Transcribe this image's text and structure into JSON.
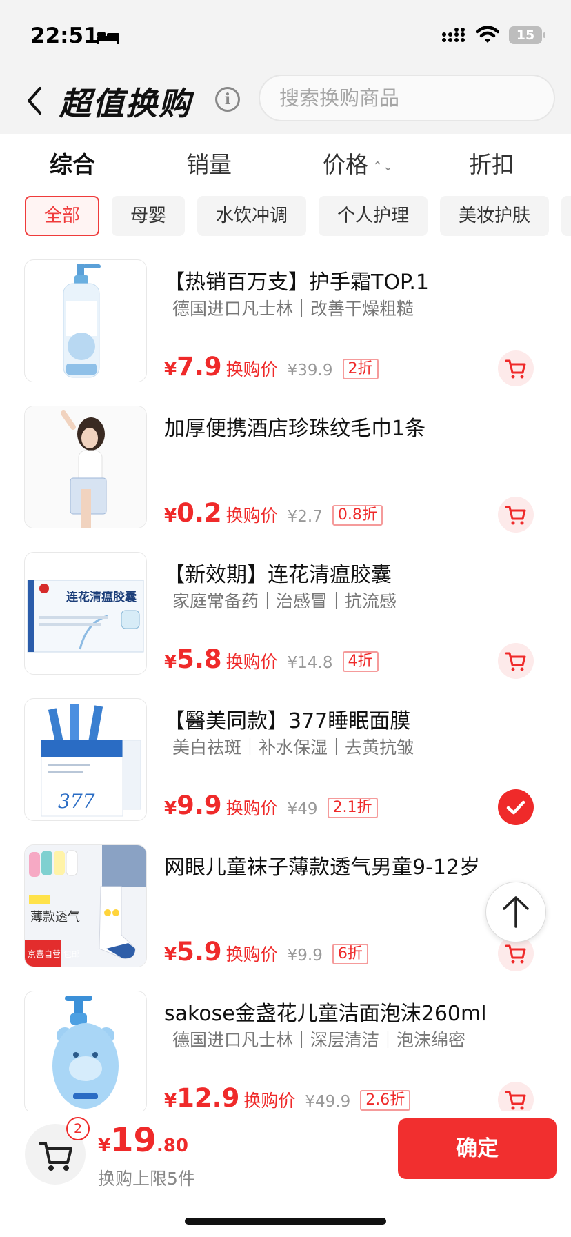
{
  "status_bar": {
    "time": "22:51",
    "battery": "15"
  },
  "header": {
    "title": "超值换购",
    "info": "i",
    "search_placeholder": "搜索换购商品"
  },
  "sort_tabs": {
    "comprehensive": "综合",
    "sales": "销量",
    "price": "价格",
    "discount": "折扣"
  },
  "categories": [
    "全部",
    "母婴",
    "水饮冲调",
    "个人护理",
    "美妆护肤"
  ],
  "products": [
    {
      "name": "【热销百万支】护手霜TOP.1",
      "subtitle": "德国进口凡士林｜改善干燥粗糙",
      "currency": "¥",
      "price": "7.9",
      "price_label": "换购价",
      "original": "¥39.9",
      "discount": "2折",
      "selected": false
    },
    {
      "name": "加厚便携酒店珍珠纹毛巾1条",
      "subtitle": "",
      "currency": "¥",
      "price": "0.2",
      "price_label": "换购价",
      "original": "¥2.7",
      "discount": "0.8折",
      "selected": false
    },
    {
      "name": "【新效期】连花清瘟胶囊",
      "subtitle": "家庭常备药｜治感冒｜抗流感",
      "currency": "¥",
      "price": "5.8",
      "price_label": "换购价",
      "original": "¥14.8",
      "discount": "4折",
      "selected": false,
      "image_text": "连花清瘟胶囊"
    },
    {
      "name": "【醫美同款】377睡眠面膜",
      "subtitle": "美白祛斑｜补水保湿｜去黄抗皱",
      "currency": "¥",
      "price": "9.9",
      "price_label": "换购价",
      "original": "¥49",
      "discount": "2.1折",
      "selected": true,
      "image_text": "377"
    },
    {
      "name": "网眼儿童袜子薄款透气男童9-12岁",
      "subtitle": "",
      "currency": "¥",
      "price": "5.9",
      "price_label": "换购价",
      "original": "¥9.9",
      "discount": "6折",
      "selected": false,
      "image_text": "薄款透气",
      "image_tag": "京喜自营 包邮"
    },
    {
      "name": "sakose金盏花儿童洁面泡沫260ml",
      "subtitle": "德国进口凡士林｜深层清洁｜泡沫绵密",
      "currency": "¥",
      "price": "12.9",
      "price_label": "换购价",
      "original": "¥49.9",
      "discount": "2.6折",
      "selected": false
    }
  ],
  "footer": {
    "cart_count": "2",
    "currency": "¥",
    "total_int": "19",
    "total_dec": ".80",
    "limit_text": "换购上限5件",
    "confirm": "确定"
  },
  "colors": {
    "accent": "#ef2a2a",
    "confirm_bg": "#f12f2f",
    "header_bg": "#f3f3f3"
  }
}
